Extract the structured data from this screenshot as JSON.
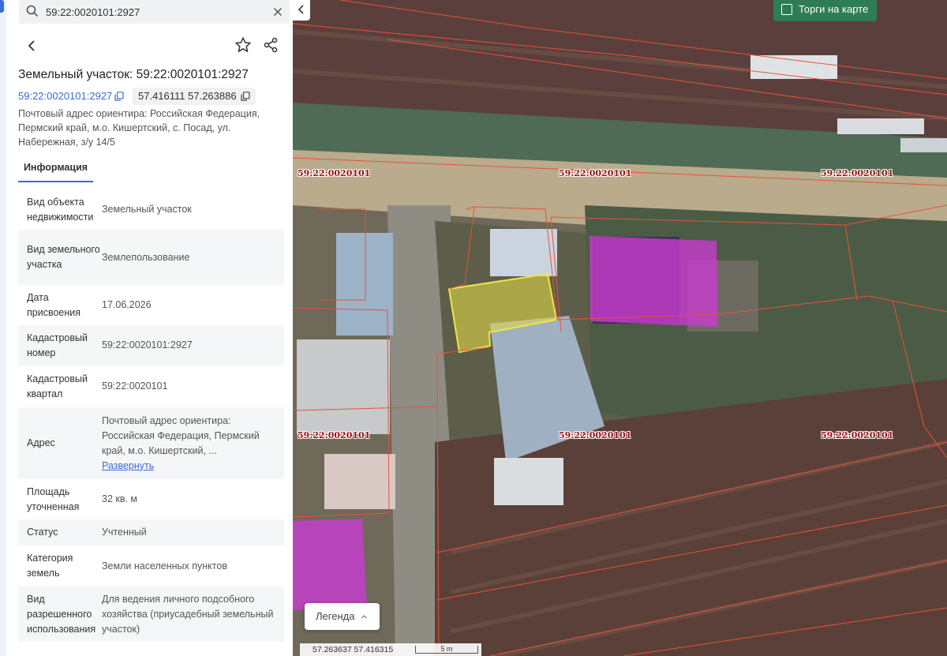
{
  "search": {
    "value": "59:22:0020101:2927",
    "placeholder": ""
  },
  "header": {
    "title": "Земельный участок: 59:22:0020101:2927",
    "cadastral_link": "59:22:0020101:2927",
    "coordinates": "57.416111 57.263886",
    "postal_address": "Почтовый адрес ориентира: Российская Федерация, Пермский край, м.о. Кишертский, с. Посад, ул. Набережная, з/у 14/5"
  },
  "tabs": [
    {
      "label": "Информация"
    }
  ],
  "info_rows": [
    {
      "label": "Вид объекта недвижимости",
      "value": "Земельный участок"
    },
    {
      "label": "Вид земельного участка",
      "value": "Землепользование"
    },
    {
      "label": "Дата присвоения",
      "value": "17.06.2026"
    },
    {
      "label": "Кадастровый номер",
      "value": "59:22:0020101:2927"
    },
    {
      "label": "Кадастровый квартал",
      "value": "59:22:0020101"
    },
    {
      "label": "Адрес",
      "value": "Почтовый адрес ориентира: Российская Федерация, Пермский край, м.о. Кишертский, ...",
      "action": "Развернуть"
    },
    {
      "label": "Площадь уточненная",
      "value": "32 кв. м"
    },
    {
      "label": "Статус",
      "value": "Учтенный"
    },
    {
      "label": "Категория земель",
      "value": "Земли населенных пунктов"
    },
    {
      "label": "Вид разрешенного использования",
      "value": "Для ведения личного подсобного хозяйства (приусадебный земельный участок)"
    }
  ],
  "map": {
    "trade_toggle_label": "Торги на карте",
    "legend_label": "Легенда",
    "cursor_coords": "57.263637  57.416315",
    "scale_label": "5 m",
    "quarter_labels": [
      "59:22:0020101",
      "59:22:0020101",
      "59:22:0020101",
      "59:22:0020101",
      "59:22:0020101",
      "59:22:0020101"
    ]
  },
  "colors": {
    "accent": "#3a6bd8",
    "trade_button": "#2e7d57",
    "selected_parcel": "#e0d84a",
    "other_parcels": "#c93bd0",
    "boundaries": "#e8523a",
    "quarter_label": "#9a1010"
  },
  "icons": [
    "search-icon",
    "close-icon",
    "back-arrow-icon",
    "star-icon",
    "share-icon",
    "copy-icon",
    "chevron-left-icon",
    "checkbox-icon",
    "chevron-up-icon"
  ]
}
